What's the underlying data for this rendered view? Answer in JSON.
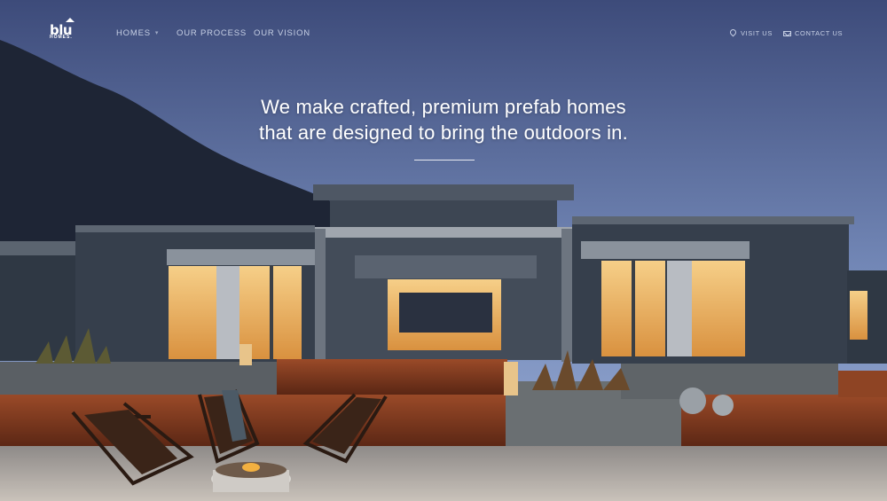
{
  "brand": {
    "logo_text": "blu",
    "logo_sub": "HOMES."
  },
  "nav": {
    "items": [
      {
        "label": "HOMES",
        "has_dropdown": true
      },
      {
        "label": "OUR PROCESS"
      },
      {
        "label": "OUR VISION"
      }
    ],
    "visit_label": "VISIT US",
    "contact_label": "CONTACT US"
  },
  "hero": {
    "headline_line1": "We make crafted, premium prefab homes",
    "headline_line2": "that are designed to bring the outdoors in."
  },
  "colors": {
    "sky_top": "#3b4a78",
    "sky_bottom": "#8fa3cf",
    "mountain": "#1f2838",
    "house_siding": "#3a4452",
    "window_glow": "#f2b860",
    "deck": "#7a3a22",
    "gravel": "#b9b3ad"
  }
}
